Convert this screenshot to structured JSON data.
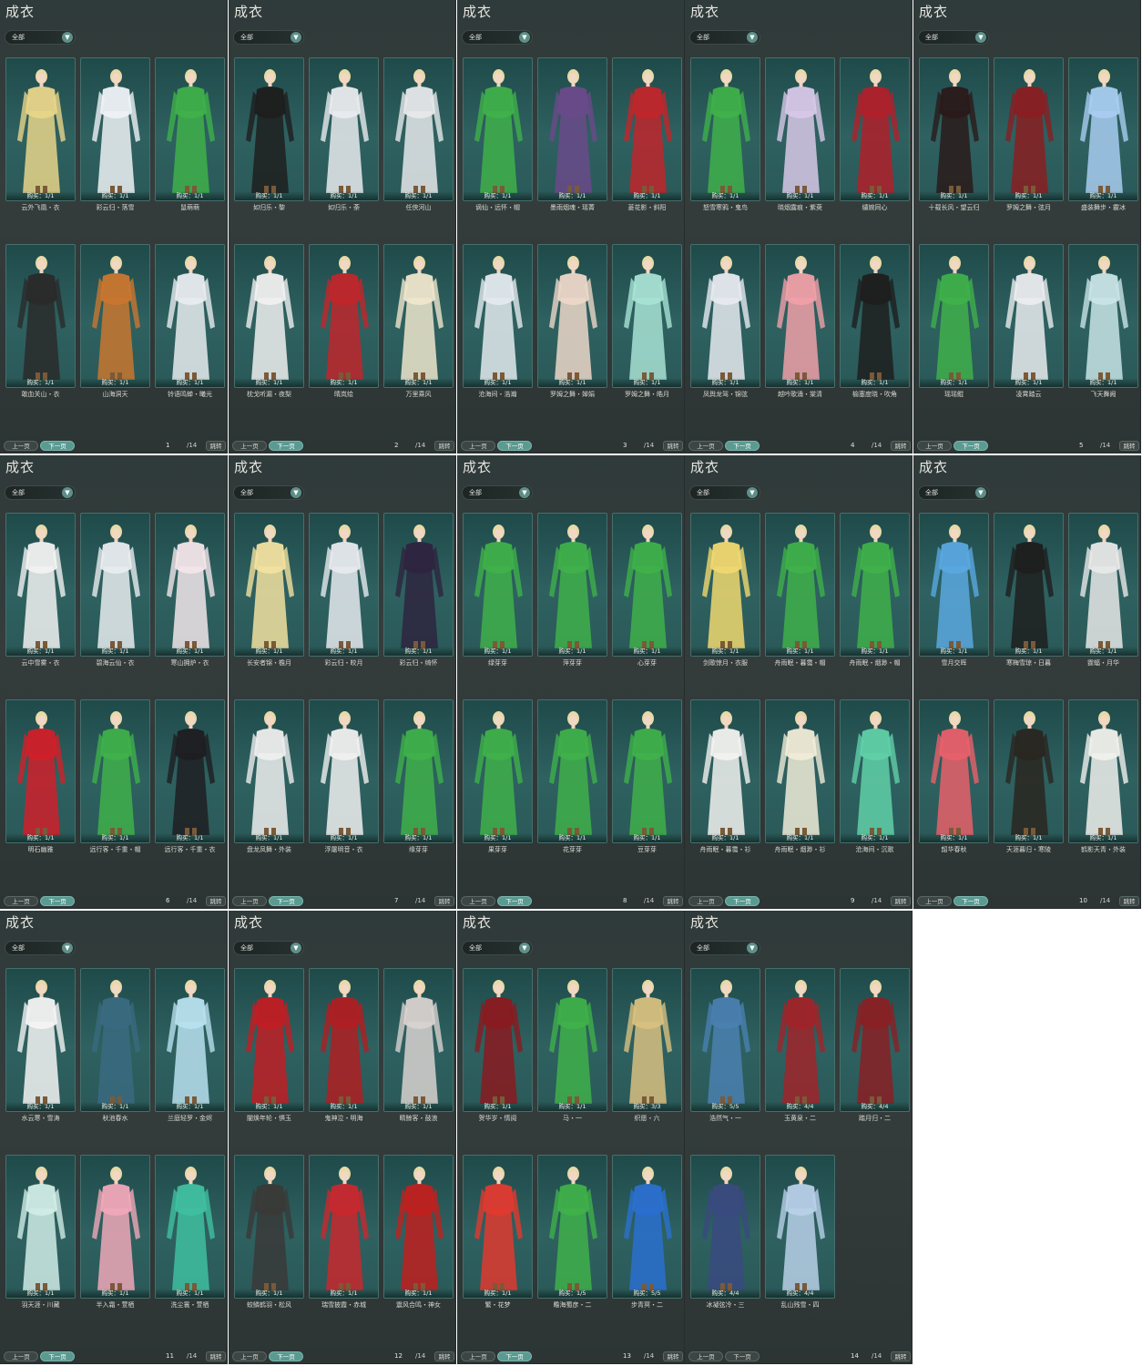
{
  "common": {
    "title": "成衣",
    "filter": "全部",
    "prev": "上一页",
    "next": "下一页",
    "jump": "跳转",
    "total": "/14"
  },
  "colors": {
    "accent": "#5a9a91",
    "card": "#2e6160",
    "panel": "#343d3c"
  },
  "pages": [
    {
      "page": "1",
      "items": [
        {
          "name": "云外飞凰・衣",
          "buy": "购买：1/1",
          "color": "#e8d58a"
        },
        {
          "name": "彩云归・落雪",
          "buy": "购买：1/1",
          "color": "#eef2f6"
        },
        {
          "name": "鼠萌萌",
          "buy": "购买：1/1",
          "color": "#3fb04a"
        },
        {
          "name": "敢血关山・衣",
          "buy": "购买：1/1",
          "color": "#2a2a2a"
        },
        {
          "name": "山海洞天",
          "buy": "购买：1/1",
          "color": "#c9772f"
        },
        {
          "name": "铃语鸣蝉・曦光",
          "buy": "购买：1/1",
          "color": "#e8ecef"
        }
      ]
    },
    {
      "page": "2",
      "items": [
        {
          "name": "如归乐・黎",
          "buy": "购买：1/1",
          "color": "#1e1e1e"
        },
        {
          "name": "如归乐・荼",
          "buy": "购买：1/1",
          "color": "#e9ebee"
        },
        {
          "name": "任侠河山",
          "buy": "购买：1/1",
          "color": "#e6e8ea"
        },
        {
          "name": "枕戈听漏・夜梨",
          "buy": "购买：1/1",
          "color": "#f0f0f0"
        },
        {
          "name": "晴岚绘",
          "buy": "购买：1/1",
          "color": "#c0262b"
        },
        {
          "name": "万里乘风",
          "buy": "购买：1/1",
          "color": "#efe6cc"
        }
      ]
    },
    {
      "page": "3",
      "items": [
        {
          "name": "谪仙・远怀・帽",
          "buy": "购买：1/1",
          "color": "#3fb04a"
        },
        {
          "name": "墨雨烟魂・瑶菁",
          "buy": "购买：1/1",
          "color": "#6a4a8a"
        },
        {
          "name": "菱花影・斜阳",
          "buy": "购买：1/1",
          "color": "#c0262b"
        },
        {
          "name": "沧海间・浩瀚",
          "buy": "购买：1/1",
          "color": "#e3eaee"
        },
        {
          "name": "罗姆之舞・婵娟",
          "buy": "购买：1/1",
          "color": "#ecd7c8"
        },
        {
          "name": "罗姆之舞・皓月",
          "buy": "购买：1/1",
          "color": "#a8e2d4"
        }
      ]
    },
    {
      "page": "4",
      "items": [
        {
          "name": "怒雪寒鸦・鬼鸟",
          "buy": "购买：1/1",
          "color": "#3fb04a"
        },
        {
          "name": "晓烟露痕・紫萸",
          "buy": "购买：1/1",
          "color": "#d8c8e8"
        },
        {
          "name": "缱婉同心",
          "buy": "购买：1/1",
          "color": "#b0202a"
        },
        {
          "name": "凤舆龙驾・锦弦",
          "buy": "购买：1/1",
          "color": "#e6eaf0"
        },
        {
          "name": "越吟歌涌・棠清",
          "buy": "购买：1/1",
          "color": "#f0a0a8"
        },
        {
          "name": "榆塞度晓・吹角",
          "buy": "购买：1/1",
          "color": "#1e1e1e"
        }
      ]
    },
    {
      "page": "5",
      "items": [
        {
          "name": "十载长风・望云归",
          "buy": "购买：1/1",
          "color": "#2a1a1a"
        },
        {
          "name": "罗姆之舞・弦月",
          "buy": "购买：1/1",
          "color": "#8a1e22"
        },
        {
          "name": "盛装舞步・霰冰",
          "buy": "购买：1/1",
          "color": "#a8cdf0"
        },
        {
          "name": "瑶瑶鲲",
          "buy": "购买：1/1",
          "color": "#3fb04a"
        },
        {
          "name": "凌霄踏云",
          "buy": "购买：1/1",
          "color": "#eaecee"
        },
        {
          "name": "飞天舞阙",
          "buy": "购买：1/1",
          "color": "#c8e4e6"
        }
      ]
    },
    {
      "page": "6",
      "items": [
        {
          "name": "云中雪雾・衣",
          "buy": "购买：1/1",
          "color": "#f2f2f2"
        },
        {
          "name": "碧海云仙・衣",
          "buy": "购买：1/1",
          "color": "#e8ecef"
        },
        {
          "name": "寒山拥炉・衣",
          "buy": "购买：1/1",
          "color": "#f2e6ea"
        },
        {
          "name": "明石幽雅",
          "buy": "购买：1/1",
          "color": "#d0202a"
        },
        {
          "name": "远行客・千重・帽",
          "buy": "购买：1/1",
          "color": "#3fb04a"
        },
        {
          "name": "远行客・千重・衣",
          "buy": "购买：1/1",
          "color": "#1e1e22"
        }
      ]
    },
    {
      "page": "7",
      "items": [
        {
          "name": "长安者锦・檐月",
          "buy": "购买：1/1",
          "color": "#f2e2a0"
        },
        {
          "name": "彩云归・皎月",
          "buy": "购买：1/1",
          "color": "#e6eaee"
        },
        {
          "name": "彩云归・绮怀",
          "buy": "购买：1/1",
          "color": "#2e2440"
        },
        {
          "name": "盘龙凤舞・外装",
          "buy": "购买：1/1",
          "color": "#eeeeee"
        },
        {
          "name": "浮屠明音・衣",
          "buy": "购买：1/1",
          "color": "#f0f0f0"
        },
        {
          "name": "缘芽芽",
          "buy": "购买：1/1",
          "color": "#3fb04a"
        }
      ]
    },
    {
      "page": "8",
      "items": [
        {
          "name": "绿芽芽",
          "buy": "购买：1/1",
          "color": "#3fb04a"
        },
        {
          "name": "萍芽芽",
          "buy": "购买：1/1",
          "color": "#3fb04a"
        },
        {
          "name": "心芽芽",
          "buy": "购买：1/1",
          "color": "#3fb04a"
        },
        {
          "name": "果芽芽",
          "buy": "购买：1/1",
          "color": "#3fb04a"
        },
        {
          "name": "花芽芽",
          "buy": "购买：1/1",
          "color": "#3fb04a"
        },
        {
          "name": "豆芽芽",
          "buy": "购买：1/1",
          "color": "#3fb04a"
        }
      ]
    },
    {
      "page": "9",
      "items": [
        {
          "name": "剑歌惊月・衣服",
          "buy": "购买：1/1",
          "color": "#f0d870"
        },
        {
          "name": "舟雨眠・暮霭・帽",
          "buy": "购买：1/1",
          "color": "#3fb04a"
        },
        {
          "name": "舟雨眠・烟渺・帽",
          "buy": "购买：1/1",
          "color": "#3fb04a"
        },
        {
          "name": "舟雨眠・暮霭・衫",
          "buy": "购买：1/1",
          "color": "#f2f2f0"
        },
        {
          "name": "舟雨眠・烟渺・衫",
          "buy": "购买：1/1",
          "color": "#f0ecd8"
        },
        {
          "name": "沧海间・沉歌",
          "buy": "购买：1/1",
          "color": "#60d0a8"
        }
      ]
    },
    {
      "page": "10",
      "items": [
        {
          "name": "雪月交晖",
          "buy": "购买：1/1",
          "color": "#5aa8e0"
        },
        {
          "name": "寒梅雪琼・日暮",
          "buy": "购买：1/1",
          "color": "#1e1e1e"
        },
        {
          "name": "霆蝠・月华",
          "buy": "购买：1/1",
          "color": "#e8e8e8"
        },
        {
          "name": "韶华春秋",
          "buy": "购买：1/1",
          "color": "#e8606a"
        },
        {
          "name": "天涯暮归・寒陵",
          "buy": "购买：1/1",
          "color": "#2a2620"
        },
        {
          "name": "鹤影天青・外装",
          "buy": "购买：1/1",
          "color": "#f0f0ec"
        }
      ]
    },
    {
      "page": "11",
      "items": [
        {
          "name": "水云寒・雪涛",
          "buy": "购买：1/1",
          "color": "#f4f4f4"
        },
        {
          "name": "秋池春水",
          "buy": "购买：1/1",
          "color": "#3a6a80"
        },
        {
          "name": "兰庭轻罗・金烬",
          "buy": "购买：1/1",
          "color": "#b8e0ee"
        },
        {
          "name": "羽天涯・川藏",
          "buy": "购买：1/1",
          "color": "#d0ece6"
        },
        {
          "name": "半入霜・萱栖",
          "buy": "购买：1/1",
          "color": "#f0a8b8"
        },
        {
          "name": "洗尘寰・萱栖",
          "buy": "购买：1/1",
          "color": "#40c0a0"
        }
      ]
    },
    {
      "page": "12",
      "items": [
        {
          "name": "闇焕年轮・惧玉",
          "buy": "购买：1/1",
          "color": "#c01e24"
        },
        {
          "name": "鬼神泣・明海",
          "buy": "购买：1/1",
          "color": "#b01e22"
        },
        {
          "name": "睛鲸客・鼓浪",
          "buy": "购买：1/1",
          "color": "#d8d2d0"
        },
        {
          "name": "蛟鳞鹤羽・松风",
          "buy": "购买：1/1",
          "color": "#3a3a38"
        },
        {
          "name": "瑞雪披霞・赤城",
          "buy": "购买：1/1",
          "color": "#c8282e"
        },
        {
          "name": "震风合鸣・神女",
          "buy": "购买：1/1",
          "color": "#c0201e"
        }
      ]
    },
    {
      "page": "13",
      "items": [
        {
          "name": "贺华岁・情阅",
          "buy": "购买：1/1",
          "color": "#8a1a20"
        },
        {
          "name": "马・一",
          "buy": "购买：1/1",
          "color": "#3fb04a"
        },
        {
          "name": "织愿・六",
          "buy": "购买：3/3",
          "color": "#d8c080"
        },
        {
          "name": "繁・花梦",
          "buy": "购买：1/1",
          "color": "#e03a30"
        },
        {
          "name": "瞻海蜀彦・二",
          "buy": "购买：1/5",
          "color": "#3fb04a"
        },
        {
          "name": "步青冥・二",
          "buy": "购买：5/5",
          "color": "#2a70d0"
        }
      ]
    },
    {
      "page": "14",
      "items": [
        {
          "name": "浩然气・一",
          "buy": "购买：5/5",
          "color": "#4a80b0"
        },
        {
          "name": "玉黄泉・二",
          "buy": "购买：4/4",
          "color": "#a0242a"
        },
        {
          "name": "踏月归・二",
          "buy": "购买：4/4",
          "color": "#8a2024"
        },
        {
          "name": "冰凝弦冷・三",
          "buy": "购买：4/4",
          "color": "#3a4a80"
        },
        {
          "name": "乱山残雪・四",
          "buy": "购买：4/4",
          "color": "#b8d0e8"
        }
      ]
    }
  ]
}
